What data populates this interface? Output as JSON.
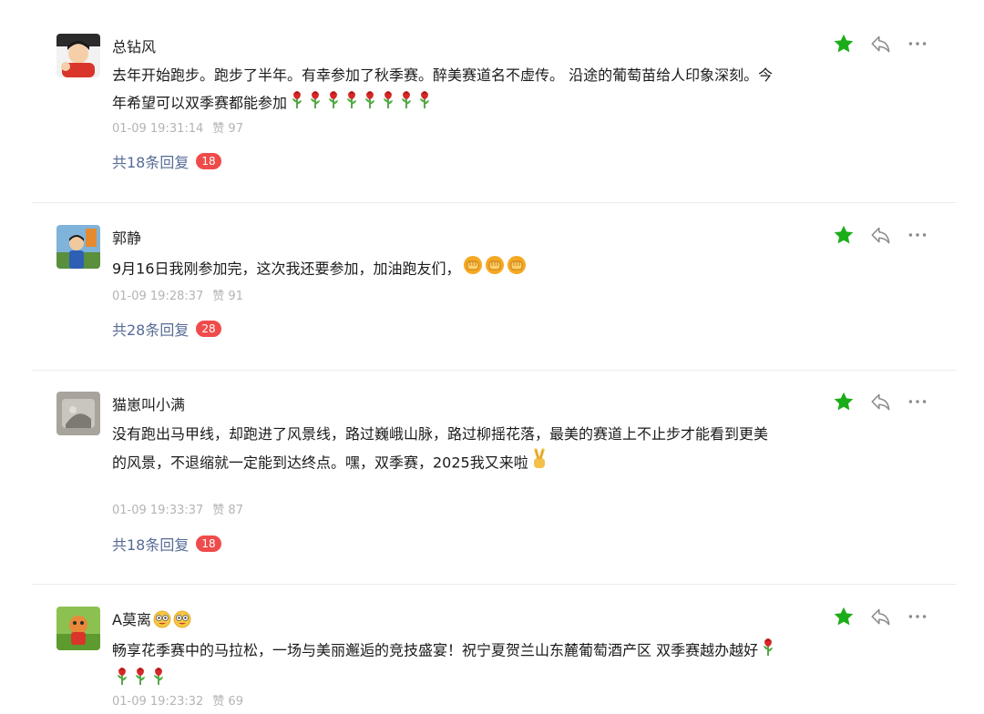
{
  "comments": [
    {
      "username": "总钻风",
      "text": "去年开始跑步。跑步了半年。有幸参加了秋季赛。醉美赛道名不虚传。 沿途的葡萄苗给人印象深刻。今年希望可以双季赛都能参加",
      "emoji": "rose",
      "emoji_count": 8,
      "time": "01-09 19:31:14",
      "likes": "赞 97",
      "replies_label": "共18条回复",
      "reply_count": "18"
    },
    {
      "username": "郭静",
      "text": "9月16日我刚参加完，这次我还要参加，加油跑友们，",
      "emoji": "fist",
      "emoji_count": 3,
      "time": "01-09 19:28:37",
      "likes": "赞 91",
      "replies_label": "共28条回复",
      "reply_count": "28"
    },
    {
      "username": "猫崽叫小满",
      "text": "没有跑出马甲线，却跑进了风景线，路过巍峨山脉，路过柳摇花落，最美的赛道上不止步才能看到更美的风景，不退缩就一定能到达终点。嘿，双季赛，2025我又来啦",
      "emoji": "victory-hand",
      "emoji_count": 1,
      "time": "01-09 19:33:37",
      "likes": "赞 87",
      "replies_label": "共18条回复",
      "reply_count": "18"
    },
    {
      "username": "A莫离",
      "username_emoji": "star-eyes",
      "text": "畅享花季赛中的马拉松，一场与美丽邂逅的竞技盛宴！祝宁夏贺兰山东麓葡萄酒产区 双季赛越办越好",
      "emoji": "rose",
      "emoji_count": 4,
      "time": "01-09 19:23:32",
      "likes": "赞 69"
    }
  ],
  "icons": {
    "star": "star-icon",
    "reply": "reply-icon",
    "more": "more-icon"
  },
  "colors": {
    "star": "#1aad19",
    "link": "#576b95",
    "badge": "#f04b4b",
    "meta": "#b4b4b4"
  }
}
